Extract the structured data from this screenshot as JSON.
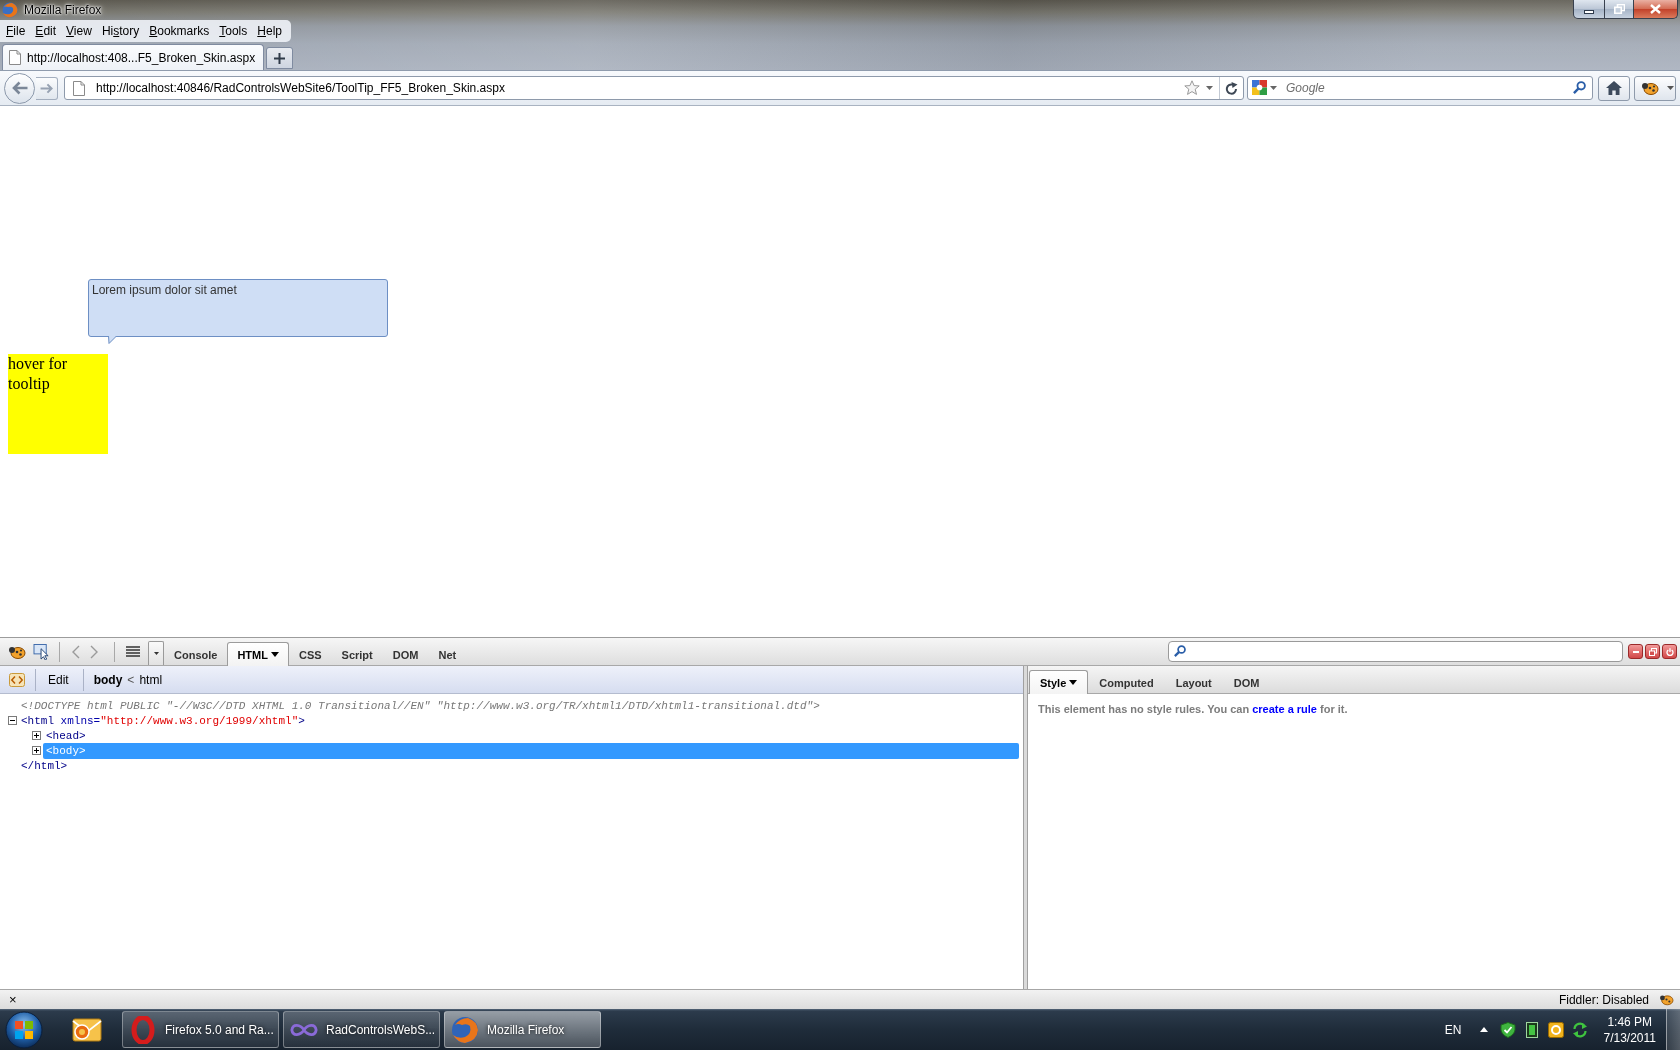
{
  "window": {
    "title": "Mozilla Firefox"
  },
  "menu_bar": [
    {
      "key": "F",
      "post": "ile"
    },
    {
      "key": "E",
      "post": "dit"
    },
    {
      "key": "V",
      "post": "iew"
    },
    {
      "pre": "Hi",
      "key": "s",
      "post": "tory"
    },
    {
      "key": "B",
      "post": "ookmarks"
    },
    {
      "key": "T",
      "post": "ools"
    },
    {
      "key": "H",
      "post": "elp"
    }
  ],
  "tabs": [
    {
      "label": "http://localhost:408...F5_Broken_Skin.aspx",
      "selected": true
    }
  ],
  "navigation": {
    "url": "http://localhost:40846/RadControlsWebSite6/ToolTip_FF5_Broken_Skin.aspx",
    "search": {
      "placeholder": "Google"
    }
  },
  "page": {
    "tooltip": {
      "text": "Lorem ipsum dolor sit amet"
    },
    "target": {
      "text": "hover for tooltip"
    }
  },
  "firebug": {
    "toolbar_tabs": [
      {
        "label": "Console",
        "selected": false,
        "has_menu": false
      },
      {
        "label": "HTML",
        "selected": true,
        "has_menu": true
      },
      {
        "label": "CSS",
        "selected": false,
        "has_menu": false
      },
      {
        "label": "Script",
        "selected": false,
        "has_menu": false
      },
      {
        "label": "DOM",
        "selected": false,
        "has_menu": false
      },
      {
        "label": "Net",
        "selected": false,
        "has_menu": false
      }
    ],
    "breadcrumb": {
      "edit": "Edit",
      "separator": "<",
      "path": [
        {
          "label": "body",
          "selected": true
        },
        {
          "label": "html",
          "selected": false
        }
      ]
    },
    "html_tree": {
      "doctype": "<!DOCTYPE html PUBLIC \"-//W3C//DTD XHTML 1.0 Transitional//EN\" \"http://www.w3.org/TR/xhtml1/DTD/xhtml1-transitional.dtd\">",
      "nodes": [
        {
          "segments": [
            {
              "text": "<html ",
              "kind": "tag"
            },
            {
              "text": "xmlns=",
              "kind": "attr"
            },
            {
              "text": "\"http://www.w3.org/1999/xhtml\"",
              "kind": "value"
            },
            {
              "text": ">",
              "kind": "tag"
            }
          ],
          "close_tag": "</html>",
          "expanded": true,
          "selected": false,
          "children": [
            {
              "segments": [
                {
                  "text": "<head>",
                  "kind": "tag"
                }
              ],
              "expanded": false,
              "selected": false
            },
            {
              "segments": [
                {
                  "text": "<body>",
                  "kind": "tag"
                }
              ],
              "expanded": false,
              "selected": true
            }
          ]
        }
      ]
    },
    "side_tabs": [
      {
        "label": "Style",
        "selected": true,
        "has_menu": true
      },
      {
        "label": "Computed",
        "selected": false,
        "has_menu": false
      },
      {
        "label": "Layout",
        "selected": false,
        "has_menu": false
      },
      {
        "label": "DOM",
        "selected": false,
        "has_menu": false
      }
    ],
    "style_message": {
      "before": "This element has no style rules. You can",
      "link": "create a rule",
      "after": "for it."
    }
  },
  "status_bar": {
    "close": "×",
    "text": "Fiddler: Disabled"
  },
  "taskbar": {
    "tasks": [
      {
        "label": "Firefox 5.0 and Ra...",
        "kind": "ring",
        "selected": false
      },
      {
        "label": "RadControlsWebS...",
        "kind": "loop",
        "selected": false
      },
      {
        "label": "Mozilla Firefox",
        "kind": "globe",
        "selected": true
      }
    ],
    "language": "EN",
    "time": "1:46 PM",
    "date": "7/13/2011"
  }
}
